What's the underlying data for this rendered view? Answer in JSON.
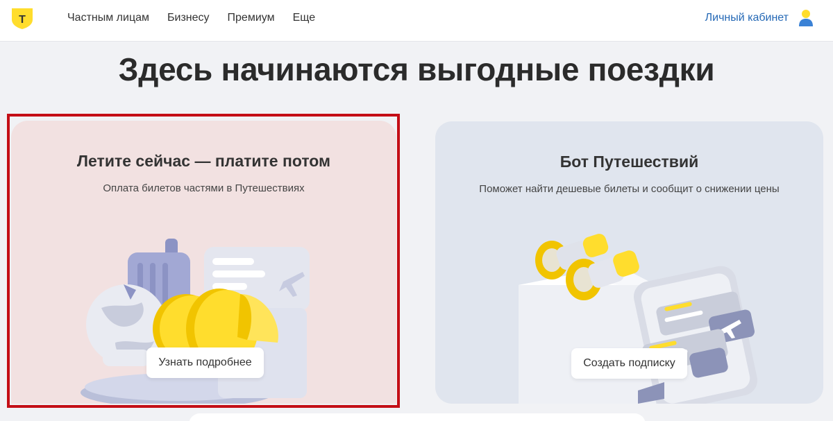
{
  "header": {
    "logo_letter": "Т",
    "nav": [
      "Частным лицам",
      "Бизнесу",
      "Премиум",
      "Еще"
    ],
    "account_label": "Личный кабинет",
    "icons": {
      "logo": "tbank-shield-logo",
      "account": "user-icon"
    }
  },
  "page_title": "Здесь начинаются выгодные поездки",
  "cards": [
    {
      "title": "Летите сейчас — платите потом",
      "subtitle": "Оплата билетов частями в Путешествиях",
      "button": "Узнать подробнее",
      "image": "suitcase-globe-coins-ticket-illustration"
    },
    {
      "title": "Бот Путешествий",
      "subtitle": "Поможет найти дешевые билеты и сообщит о снижении цены",
      "button": "Создать подписку",
      "image": "binoculars-phone-tickets-illustration"
    }
  ],
  "colors": {
    "accent_logo": "#ffdd2d",
    "link": "#2468b5",
    "highlight_border": "#c40e16",
    "card_1_bg": "#f2e1e1",
    "card_2_bg": "#e0e5ee"
  }
}
